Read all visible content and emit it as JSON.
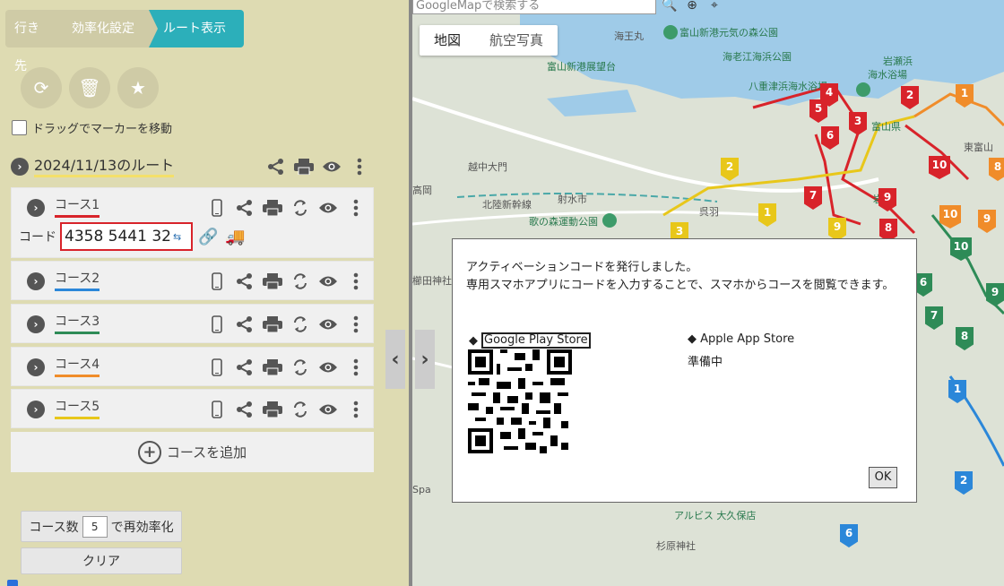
{
  "steps": [
    "行き先",
    "効率化設定",
    "ルート表示"
  ],
  "drag_label": "ドラッグでマーカーを移動",
  "route": {
    "title": "2024/11/13のルート"
  },
  "courses": [
    {
      "name": "コース1",
      "color": "#d8232a"
    },
    {
      "name": "コース2",
      "color": "#2b87d9"
    },
    {
      "name": "コース3",
      "color": "#2e8b57"
    },
    {
      "name": "コース4",
      "color": "#f08c2a"
    },
    {
      "name": "コース5",
      "color": "#e8c71a"
    }
  ],
  "code": {
    "label": "コード",
    "value": "4358 5441 32"
  },
  "add_course": "コースを追加",
  "reoptimize": {
    "prefix": "コース数",
    "count": "5",
    "suffix": "で再効率化"
  },
  "clear": "クリア",
  "map": {
    "search_placeholder": "GoogleMapで検索する",
    "type_map": "地図",
    "type_sat": "航空写真",
    "labels": [
      {
        "t": "富山新港元気の森公園",
        "c": "g"
      },
      {
        "t": "海老江海浜公園",
        "c": "g"
      },
      {
        "t": "海王丸",
        "c": "n"
      },
      {
        "t": "富山新港展望台",
        "c": "g"
      },
      {
        "t": "八重津浜海水浴場",
        "c": "g"
      },
      {
        "t": "岩瀬浜",
        "c": "g"
      },
      {
        "t": "海水浴場",
        "c": "g"
      },
      {
        "t": "射水市",
        "c": "n"
      },
      {
        "t": "歌の森運動公園",
        "c": "g"
      },
      {
        "t": "越中大門",
        "c": "n"
      },
      {
        "t": "北陸新幹線",
        "c": "n"
      },
      {
        "t": "高岡",
        "c": "n"
      },
      {
        "t": "呉羽",
        "c": "n"
      },
      {
        "t": "櫛田神社",
        "c": "n"
      },
      {
        "t": "富山県",
        "c": "n"
      },
      {
        "t": "東富山",
        "c": "n"
      },
      {
        "t": "アルビス 大久保店",
        "c": "g"
      },
      {
        "t": "杉原神社",
        "c": "n"
      },
      {
        "t": "岩瀬",
        "c": "n"
      },
      {
        "t": "Spa",
        "c": "n"
      }
    ],
    "markers": [
      {
        "n": "4",
        "c": "#d8232a"
      },
      {
        "n": "2",
        "c": "#d8232a"
      },
      {
        "n": "5",
        "c": "#d8232a"
      },
      {
        "n": "3",
        "c": "#d8232a"
      },
      {
        "n": "6",
        "c": "#d8232a"
      },
      {
        "n": "10",
        "c": "#d8232a"
      },
      {
        "n": "7",
        "c": "#d8232a"
      },
      {
        "n": "9",
        "c": "#d8232a"
      },
      {
        "n": "8",
        "c": "#d8232a"
      },
      {
        "n": "1",
        "c": "#f08c2a"
      },
      {
        "n": "8",
        "c": "#f08c2a"
      },
      {
        "n": "10",
        "c": "#f08c2a"
      },
      {
        "n": "9",
        "c": "#f08c2a"
      },
      {
        "n": "2",
        "c": "#e8c71a"
      },
      {
        "n": "1",
        "c": "#e8c71a"
      },
      {
        "n": "9",
        "c": "#e8c71a"
      },
      {
        "n": "3",
        "c": "#e8c71a"
      },
      {
        "n": "10",
        "c": "#2e8b57"
      },
      {
        "n": "6",
        "c": "#2e8b57"
      },
      {
        "n": "7",
        "c": "#2e8b57"
      },
      {
        "n": "8",
        "c": "#2e8b57"
      },
      {
        "n": "9",
        "c": "#2e8b57"
      },
      {
        "n": "1",
        "c": "#2b87d9"
      },
      {
        "n": "2",
        "c": "#2b87d9"
      },
      {
        "n": "6",
        "c": "#2b87d9"
      }
    ]
  },
  "dialog": {
    "message": "アクティベーションコードを発行しました。\n専用スマホアプリにコードを入力することで、スマホからコースを閲覧できます。",
    "google_play": "Google Play Store",
    "apple": "Apple App Store",
    "apple_status": "準備中",
    "ok": "OK"
  }
}
